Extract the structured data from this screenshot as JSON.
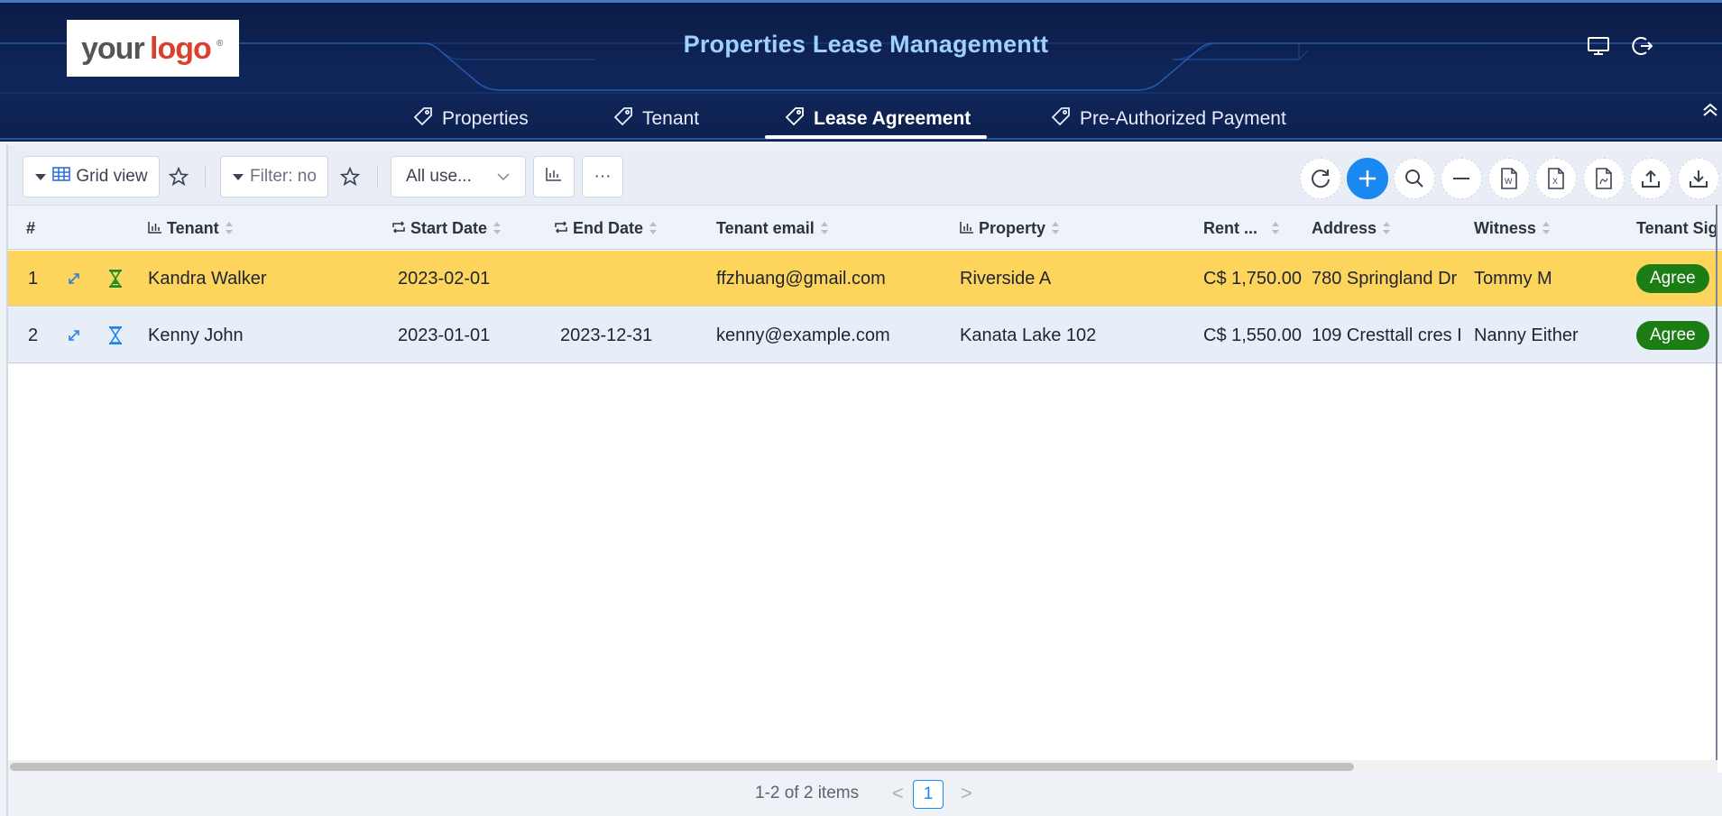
{
  "header": {
    "logo_text": "your logo®",
    "title": "Properties Lease Managementt",
    "icons": [
      "monitor-icon",
      "logout-icon"
    ]
  },
  "tabs": [
    {
      "label": "Properties",
      "icon": "tag-icon",
      "active": false
    },
    {
      "label": "Tenant",
      "icon": "tag-icon",
      "active": false
    },
    {
      "label": "Lease Agreement",
      "icon": "tag-icon",
      "active": true
    },
    {
      "label": "Pre-Authorized Payment",
      "icon": "tag-icon",
      "active": false
    }
  ],
  "toolbar": {
    "view_label": "Grid view",
    "filter_label": "Filter: no",
    "user_select": "All use...",
    "more_label": "···",
    "right_icons": [
      "refresh-icon",
      "add-icon",
      "search-icon",
      "minus-icon",
      "word-export-icon",
      "excel-export-icon",
      "pdf-export-icon",
      "upload-icon",
      "download-icon"
    ]
  },
  "columns": {
    "num": "#",
    "tenant": "Tenant",
    "start_date": "Start Date",
    "end_date": "End Date",
    "tenant_email": "Tenant email",
    "property": "Property",
    "rent": "Rent ...",
    "address": "Address",
    "witness": "Witness",
    "tenant_sig": "Tenant Sig"
  },
  "rows": [
    {
      "num": "1",
      "tenant": "Kandra Walker",
      "start_date": "2023-02-01",
      "end_date": "",
      "tenant_email": "ffzhuang@gmail.com",
      "property": "Riverside A",
      "rent": "C$ 1,750.00",
      "address": "780 Springland Dr",
      "witness": "Tommy M",
      "tenant_sig": "Agree"
    },
    {
      "num": "2",
      "tenant": "Kenny John",
      "start_date": "2023-01-01",
      "end_date": "2023-12-31",
      "tenant_email": "kenny@example.com",
      "property": "Kanata Lake 102",
      "rent": "C$ 1,550.00",
      "address": "109 Cresttall cres I",
      "witness": "Nanny Either",
      "tenant_sig": "Agree"
    }
  ],
  "pager": {
    "summary": "1-2 of 2 items",
    "prev": "<",
    "page": "1",
    "next": ">"
  },
  "colors": {
    "header_bg": "#0d2150",
    "title": "#9fd0ff",
    "accent": "#1a88f0",
    "row_highlight": "#fdd55c",
    "badge": "#1b7d14"
  }
}
